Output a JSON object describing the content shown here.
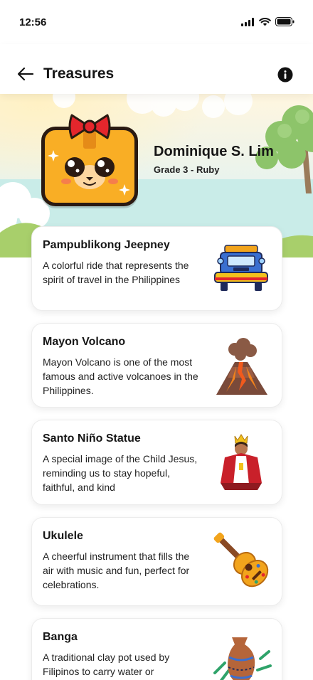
{
  "status": {
    "time": "12:56"
  },
  "header": {
    "title": "Treasures",
    "back_icon": "arrow-left-icon",
    "info_icon": "info-icon"
  },
  "profile": {
    "name": "Dominique S. Lim",
    "grade": "Grade 3 - Ruby"
  },
  "treasures": [
    {
      "title": "Pampublikong Jeepney",
      "description": "A colorful ride that represents the spirit of travel in the Philippines",
      "icon": "jeepney-illustration"
    },
    {
      "title": "Mayon Volcano",
      "description": "Mayon Volcano is one of the most famous and active volcanoes in the Philippines.",
      "icon": "volcano-illustration"
    },
    {
      "title": "Santo Niño Statue",
      "description": "A special image of the Child Jesus, reminding us to stay hopeful, faithful, and kind",
      "icon": "santo-nino-illustration"
    },
    {
      "title": "Ukulele",
      "description": "A cheerful instrument that fills the air with music and fun, perfect for celebrations.",
      "icon": "ukulele-illustration"
    },
    {
      "title": "Banga",
      "description": "A traditional clay pot used by Filipinos to carry water or",
      "icon": "banga-illustration"
    }
  ],
  "colors": {
    "avatar_bg": "#f9ae25",
    "bow": "#e4262c",
    "text": "#161616"
  }
}
